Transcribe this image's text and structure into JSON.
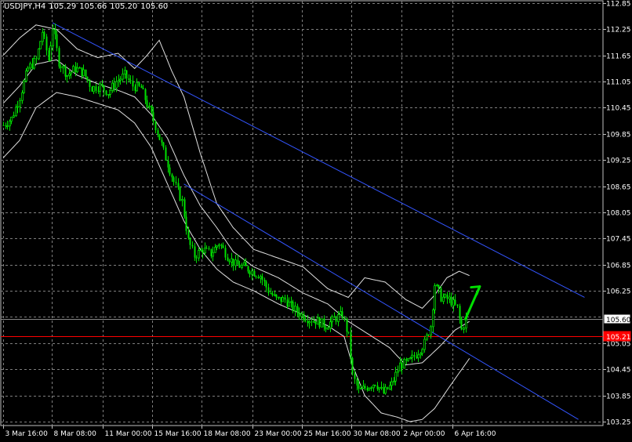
{
  "header": {
    "symbol": "USDJPY,H4",
    "open": "105.29",
    "high": "105.66",
    "low": "105.20",
    "close": "105.60"
  },
  "chart_data": {
    "type": "candlestick",
    "symbol": "USDJPY",
    "timeframe": "H4",
    "ylim": [
      103.25,
      112.85
    ],
    "y_ticks": [
      "112.85",
      "112.25",
      "111.65",
      "111.05",
      "110.45",
      "109.85",
      "109.25",
      "108.65",
      "108.05",
      "107.45",
      "106.85",
      "106.25",
      "105.65",
      "105.05",
      "104.45",
      "103.85",
      "103.25"
    ],
    "x_ticks": [
      "3 Mar 16:00",
      "8 Mar 08:00",
      "11 Mar 00:00",
      "15 Mar 16:00",
      "18 Mar 08:00",
      "23 Mar 00:00",
      "25 Mar 16:00",
      "30 Mar 08:00",
      "2 Apr 00:00",
      "6 Apr 16:00"
    ],
    "grid": true,
    "price_markers": [
      {
        "label": "105.60",
        "value": 105.6,
        "color": "#c0c0c0",
        "role": "bid"
      },
      {
        "label": "105.21",
        "value": 105.21,
        "color": "#ff0000",
        "role": "level"
      }
    ],
    "price_path": [
      {
        "i": 0,
        "v": 110.05
      },
      {
        "i": 4,
        "v": 110.2
      },
      {
        "i": 8,
        "v": 110.7
      },
      {
        "i": 12,
        "v": 111.35
      },
      {
        "i": 16,
        "v": 111.55
      },
      {
        "i": 19,
        "v": 112.2
      },
      {
        "i": 22,
        "v": 111.55
      },
      {
        "i": 24,
        "v": 112.3
      },
      {
        "i": 27,
        "v": 111.5
      },
      {
        "i": 31,
        "v": 111.2
      },
      {
        "i": 35,
        "v": 111.35
      },
      {
        "i": 39,
        "v": 111.25
      },
      {
        "i": 43,
        "v": 110.9
      },
      {
        "i": 47,
        "v": 110.95
      },
      {
        "i": 51,
        "v": 110.8
      },
      {
        "i": 55,
        "v": 111.05
      },
      {
        "i": 59,
        "v": 111.2
      },
      {
        "i": 63,
        "v": 110.95
      },
      {
        "i": 67,
        "v": 110.9
      },
      {
        "i": 71,
        "v": 110.4
      },
      {
        "i": 75,
        "v": 109.9
      },
      {
        "i": 79,
        "v": 109.3
      },
      {
        "i": 83,
        "v": 108.75
      },
      {
        "i": 87,
        "v": 108.3
      },
      {
        "i": 90,
        "v": 107.4
      },
      {
        "i": 93,
        "v": 107.05
      },
      {
        "i": 97,
        "v": 107.2
      },
      {
        "i": 101,
        "v": 107.1
      },
      {
        "i": 105,
        "v": 107.35
      },
      {
        "i": 109,
        "v": 107.05
      },
      {
        "i": 113,
        "v": 106.85
      },
      {
        "i": 117,
        "v": 106.8
      },
      {
        "i": 121,
        "v": 106.7
      },
      {
        "i": 125,
        "v": 106.6
      },
      {
        "i": 129,
        "v": 106.25
      },
      {
        "i": 133,
        "v": 106.05
      },
      {
        "i": 137,
        "v": 106.05
      },
      {
        "i": 141,
        "v": 105.85
      },
      {
        "i": 145,
        "v": 105.7
      },
      {
        "i": 149,
        "v": 105.6
      },
      {
        "i": 153,
        "v": 105.55
      },
      {
        "i": 157,
        "v": 105.45
      },
      {
        "i": 161,
        "v": 105.6
      },
      {
        "i": 165,
        "v": 105.7
      },
      {
        "i": 168,
        "v": 105.2
      },
      {
        "i": 170,
        "v": 104.3
      },
      {
        "i": 173,
        "v": 103.95
      },
      {
        "i": 177,
        "v": 104.05
      },
      {
        "i": 181,
        "v": 104.15
      },
      {
        "i": 185,
        "v": 103.9
      },
      {
        "i": 189,
        "v": 104.1
      },
      {
        "i": 193,
        "v": 104.55
      },
      {
        "i": 197,
        "v": 104.6
      },
      {
        "i": 201,
        "v": 104.8
      },
      {
        "i": 205,
        "v": 105.05
      },
      {
        "i": 208,
        "v": 105.45
      },
      {
        "i": 210,
        "v": 106.4
      },
      {
        "i": 213,
        "v": 106.1
      },
      {
        "i": 217,
        "v": 106.05
      },
      {
        "i": 221,
        "v": 105.85
      },
      {
        "i": 223,
        "v": 105.35
      },
      {
        "i": 225,
        "v": 105.6
      }
    ],
    "bollinger_upper": [
      {
        "i": 0,
        "v": 111.65
      },
      {
        "i": 8,
        "v": 112.05
      },
      {
        "i": 16,
        "v": 112.35
      },
      {
        "i": 26,
        "v": 112.25
      },
      {
        "i": 36,
        "v": 111.8
      },
      {
        "i": 46,
        "v": 111.6
      },
      {
        "i": 56,
        "v": 111.7
      },
      {
        "i": 64,
        "v": 111.35
      },
      {
        "i": 70,
        "v": 111.65
      },
      {
        "i": 76,
        "v": 112.0
      },
      {
        "i": 82,
        "v": 111.3
      },
      {
        "i": 88,
        "v": 110.7
      },
      {
        "i": 96,
        "v": 109.4
      },
      {
        "i": 104,
        "v": 108.25
      },
      {
        "i": 112,
        "v": 107.7
      },
      {
        "i": 122,
        "v": 107.2
      },
      {
        "i": 134,
        "v": 107.0
      },
      {
        "i": 146,
        "v": 106.8
      },
      {
        "i": 158,
        "v": 106.3
      },
      {
        "i": 168,
        "v": 106.1
      },
      {
        "i": 176,
        "v": 106.55
      },
      {
        "i": 186,
        "v": 106.45
      },
      {
        "i": 196,
        "v": 106.05
      },
      {
        "i": 204,
        "v": 105.85
      },
      {
        "i": 210,
        "v": 106.15
      },
      {
        "i": 216,
        "v": 106.55
      },
      {
        "i": 222,
        "v": 106.7
      },
      {
        "i": 227,
        "v": 106.6
      }
    ],
    "bollinger_middle": [
      {
        "i": 0,
        "v": 110.55
      },
      {
        "i": 8,
        "v": 110.95
      },
      {
        "i": 16,
        "v": 111.45
      },
      {
        "i": 26,
        "v": 111.55
      },
      {
        "i": 36,
        "v": 111.2
      },
      {
        "i": 46,
        "v": 111.0
      },
      {
        "i": 56,
        "v": 110.85
      },
      {
        "i": 64,
        "v": 110.7
      },
      {
        "i": 72,
        "v": 110.3
      },
      {
        "i": 80,
        "v": 109.75
      },
      {
        "i": 88,
        "v": 108.9
      },
      {
        "i": 96,
        "v": 108.2
      },
      {
        "i": 104,
        "v": 107.7
      },
      {
        "i": 112,
        "v": 107.15
      },
      {
        "i": 122,
        "v": 106.8
      },
      {
        "i": 134,
        "v": 106.55
      },
      {
        "i": 146,
        "v": 106.2
      },
      {
        "i": 158,
        "v": 105.95
      },
      {
        "i": 168,
        "v": 105.55
      },
      {
        "i": 178,
        "v": 105.25
      },
      {
        "i": 188,
        "v": 104.95
      },
      {
        "i": 196,
        "v": 104.55
      },
      {
        "i": 204,
        "v": 104.6
      },
      {
        "i": 212,
        "v": 104.95
      },
      {
        "i": 220,
        "v": 105.35
      },
      {
        "i": 227,
        "v": 105.55
      }
    ],
    "bollinger_lower": [
      {
        "i": 0,
        "v": 109.3
      },
      {
        "i": 8,
        "v": 109.7
      },
      {
        "i": 16,
        "v": 110.45
      },
      {
        "i": 26,
        "v": 110.8
      },
      {
        "i": 36,
        "v": 110.7
      },
      {
        "i": 46,
        "v": 110.55
      },
      {
        "i": 56,
        "v": 110.4
      },
      {
        "i": 64,
        "v": 110.1
      },
      {
        "i": 72,
        "v": 109.55
      },
      {
        "i": 80,
        "v": 108.7
      },
      {
        "i": 88,
        "v": 107.85
      },
      {
        "i": 96,
        "v": 107.2
      },
      {
        "i": 104,
        "v": 106.75
      },
      {
        "i": 112,
        "v": 106.45
      },
      {
        "i": 122,
        "v": 106.25
      },
      {
        "i": 134,
        "v": 105.95
      },
      {
        "i": 146,
        "v": 105.7
      },
      {
        "i": 158,
        "v": 105.45
      },
      {
        "i": 166,
        "v": 105.2
      },
      {
        "i": 170,
        "v": 104.55
      },
      {
        "i": 176,
        "v": 103.85
      },
      {
        "i": 184,
        "v": 103.45
      },
      {
        "i": 192,
        "v": 103.35
      },
      {
        "i": 198,
        "v": 103.25
      },
      {
        "i": 204,
        "v": 103.3
      },
      {
        "i": 210,
        "v": 103.55
      },
      {
        "i": 218,
        "v": 104.1
      },
      {
        "i": 227,
        "v": 104.7
      }
    ],
    "trend_lines": [
      {
        "name": "upper-channel",
        "color": "#3355ff",
        "from": {
          "i": 24,
          "v": 112.4
        },
        "to": {
          "i": 283,
          "v": 106.1
        }
      },
      {
        "name": "lower-channel",
        "color": "#3355ff",
        "from": {
          "i": 88,
          "v": 108.7
        },
        "to": {
          "i": 280,
          "v": 103.3
        }
      }
    ],
    "arrow": {
      "color": "#00e000",
      "from": {
        "i": 225,
        "v": 105.6
      },
      "to": {
        "i": 232,
        "v": 106.35
      }
    },
    "colors": {
      "background": "#000000",
      "grid": "#7f7f7f",
      "candle": "#00e000",
      "band": "#e0e0e0",
      "axis_text": "#ffffff"
    }
  }
}
